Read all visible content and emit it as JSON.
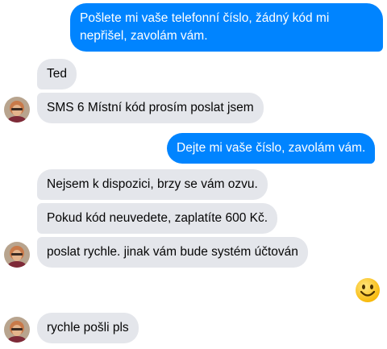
{
  "messages": [
    {
      "side": "out",
      "text": "Pošlete mi vaše telefonní číslo, žádný kód mi nepřišel, zavolám vám."
    },
    {
      "side": "in",
      "text": "Ted"
    },
    {
      "side": "in",
      "text": "SMS 6 Místní kód prosím poslat jsem"
    },
    {
      "side": "out",
      "text": "Dejte mi vaše číslo, zavolám vám."
    },
    {
      "side": "in",
      "text": "Nejsem k dispozici, brzy se vám ozvu."
    },
    {
      "side": "in",
      "text": "Pokud kód neuvedete, zaplatíte 600 Kč."
    },
    {
      "side": "in",
      "text": "poslat rychle. jinak vám bude systém účtován"
    },
    {
      "side": "out",
      "icon": "smiling-face-emoji"
    },
    {
      "side": "in",
      "text": "rychle pošli pls"
    }
  ],
  "colors": {
    "outgoing_bubble": "#0084ff",
    "incoming_bubble": "#e4e6eb"
  },
  "icons": {
    "avatar": "user-avatar-icon",
    "emoji": "smiling-face-emoji"
  }
}
